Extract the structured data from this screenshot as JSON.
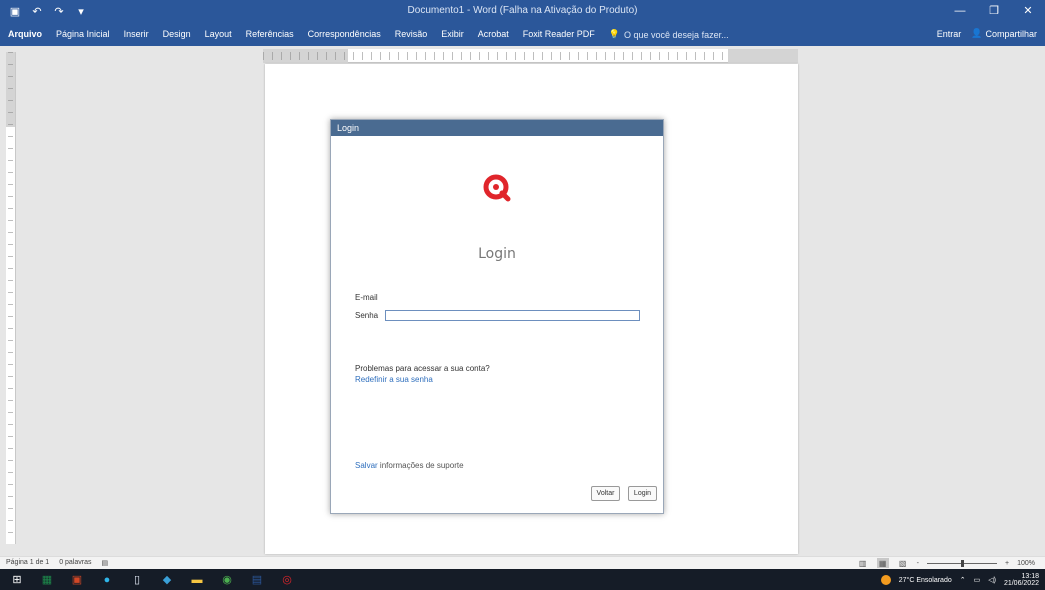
{
  "window": {
    "title": "Documento1 - Word (Falha na Ativação do Produto)",
    "controls": {
      "minimize": "—",
      "restore": "❐",
      "close": "✕"
    }
  },
  "qat": {
    "save_icon": "save-icon",
    "undo_icon": "undo-icon",
    "redo_icon": "redo-icon",
    "more_icon": "customize-icon"
  },
  "ribbon": {
    "tabs": [
      "Arquivo",
      "Página Inicial",
      "Inserir",
      "Design",
      "Layout",
      "Referências",
      "Correspondências",
      "Revisão",
      "Exibir",
      "Acrobat",
      "Foxit Reader PDF"
    ],
    "tell_me": "O que você deseja fazer...",
    "signin": "Entrar",
    "share": "Compartilhar"
  },
  "dialog": {
    "title": "Login",
    "heading": "Login",
    "email_label": "E-mail",
    "email_value": "",
    "password_label": "Senha",
    "password_value": "",
    "help_text": "Problemas para acessar a sua conta?",
    "reset_link": "Redefinir a sua senha",
    "support_link": "Salvar",
    "support_text": "informações de suporte",
    "exit_button": "Voltar",
    "login_button": "Login",
    "logo_color": "#e0252b"
  },
  "statusbar": {
    "page": "Página 1 de 1",
    "words": "0 palavras",
    "language_icon": "proofing-icon",
    "zoom_minus": "-",
    "zoom_plus": "+",
    "zoom_level": "100%"
  },
  "taskbar": {
    "apps": [
      {
        "name": "start-icon",
        "color": "#ffffff"
      },
      {
        "name": "excel-icon",
        "color": "#1d8a4b"
      },
      {
        "name": "powerpoint-icon",
        "color": "#d24726"
      },
      {
        "name": "edge-icon",
        "color": "#2fb5e8"
      },
      {
        "name": "file-icon",
        "color": "#dfe6f2"
      },
      {
        "name": "app-icon",
        "color": "#3aa0d8"
      },
      {
        "name": "folder-icon",
        "color": "#f5c542"
      },
      {
        "name": "chrome-icon",
        "color": "#4caf50"
      },
      {
        "name": "word-icon",
        "color": "#2b579a"
      },
      {
        "name": "qlik-icon",
        "color": "#e0252b"
      }
    ],
    "weather": "27°C Ensolarado",
    "time": "13:18",
    "date": "21/06/2022"
  }
}
